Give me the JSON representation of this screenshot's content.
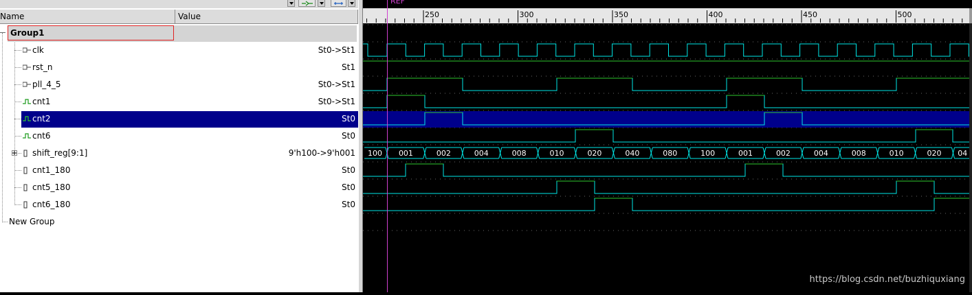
{
  "header": {
    "name_col": "Name",
    "value_col": "Value"
  },
  "signals": [
    {
      "label": "Group1",
      "value": "",
      "kind": "group",
      "name": "group1-row"
    },
    {
      "label": "clk",
      "value": "St0->St1",
      "kind": "input",
      "name": "signal-clk"
    },
    {
      "label": "rst_n",
      "value": "St1",
      "kind": "input",
      "name": "signal-rst-n"
    },
    {
      "label": "pll_4_5",
      "value": "St0->St1",
      "kind": "input",
      "name": "signal-pll-4-5"
    },
    {
      "label": "cnt1",
      "value": "St0->St1",
      "kind": "wire",
      "name": "signal-cnt1"
    },
    {
      "label": "cnt2",
      "value": "St0",
      "kind": "wire",
      "name": "signal-cnt2"
    },
    {
      "label": "cnt6",
      "value": "St0",
      "kind": "wire",
      "name": "signal-cnt6"
    },
    {
      "label": "shift_reg[9:1]",
      "value": "9'h100->9'h001",
      "kind": "bus",
      "name": "signal-shift-reg"
    },
    {
      "label": "cnt1_180",
      "value": "St0",
      "kind": "reg",
      "name": "signal-cnt1-180"
    },
    {
      "label": "cnt5_180",
      "value": "St0",
      "kind": "reg",
      "name": "signal-cnt5-180"
    },
    {
      "label": "cnt6_180",
      "value": "St0",
      "kind": "reg",
      "name": "signal-cnt6-180"
    },
    {
      "label": "New Group",
      "value": "",
      "kind": "newgroup",
      "name": "new-group-row"
    }
  ],
  "selected_signal": "cnt2",
  "timeline": {
    "marker_label": "REF",
    "ticks": [
      "250",
      "300",
      "350",
      "400",
      "450",
      "500"
    ]
  },
  "bus_values": [
    "100",
    "001",
    "002",
    "004",
    "008",
    "010",
    "020",
    "040",
    "080",
    "100",
    "001",
    "002",
    "004",
    "008",
    "010",
    "020",
    "04"
  ],
  "watermark": "https://blog.csdn.net/buzhiquxiang",
  "colors": {
    "waveform_high": "#2ec82e",
    "waveform_low": "#00e8e8",
    "selection": "#00008b",
    "cursor": "#d040d0",
    "group_outline": "#e02020",
    "group_fill": "#d4d4d4",
    "bus_edge": "#00e8e8"
  },
  "icons": {
    "input": "input-port-icon",
    "wire": "wire-icon",
    "bus": "bus-icon",
    "reg": "register-icon",
    "expand": "expand-plus-icon",
    "collapse": "collapse-minus-icon"
  }
}
